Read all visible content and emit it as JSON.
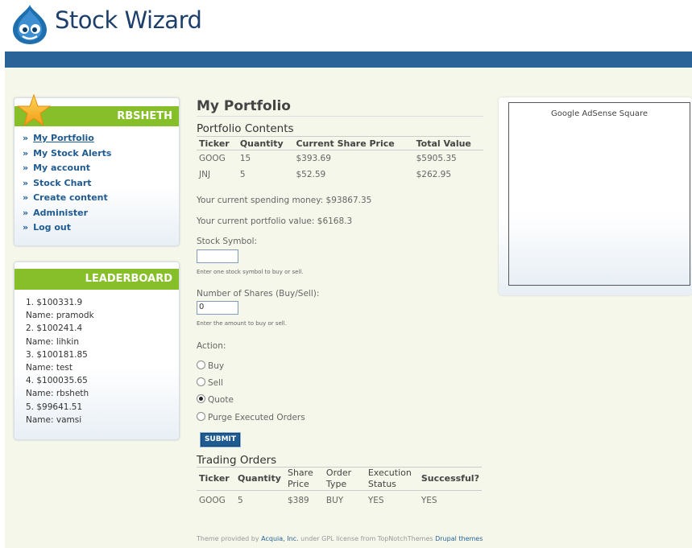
{
  "site": {
    "title": "Stock Wizard"
  },
  "user_block": {
    "title": "RBSHETH",
    "menu": [
      {
        "label": "My Portfolio",
        "active": true
      },
      {
        "label": "My Stock Alerts"
      },
      {
        "label": "My account"
      },
      {
        "label": "Stock Chart"
      },
      {
        "label": "Create content"
      },
      {
        "label": "Administer"
      },
      {
        "label": "Log out"
      }
    ],
    "bullet": "»"
  },
  "leaderboard": {
    "title": "LEADERBOARD",
    "lines": [
      "1. $100331.9",
      "Name: pramodk",
      "2. $100241.4",
      "Name: lihkin",
      "3. $100181.85",
      "Name: test",
      "4. $100035.65",
      "Name: rbsheth",
      "5. $99641.51",
      "Name: vamsi"
    ]
  },
  "main": {
    "page_title": "My Portfolio",
    "portfolio_heading": "Portfolio Contents",
    "portfolio_headers": [
      "Ticker",
      "Quantity",
      "Current Share Price",
      "Total Value"
    ],
    "portfolio_rows": [
      [
        "GOOG",
        "15",
        "$393.69",
        "$5905.35"
      ],
      [
        "JNJ",
        "5",
        "$52.59",
        "$262.95"
      ]
    ],
    "spending_money": "Your current spending money: $93867.35",
    "portfolio_value": "Your current portfolio value: $6168.3",
    "symbol_label": "Stock Symbol:",
    "symbol_value": "",
    "symbol_help": "Enter one stock symbol to buy or sell.",
    "shares_label": "Number of Shares (Buy/Sell):",
    "shares_value": "0",
    "shares_help": "Enter the amount to buy or sell.",
    "action_label": "Action:",
    "actions": [
      {
        "label": "Buy",
        "selected": false
      },
      {
        "label": "Sell",
        "selected": false
      },
      {
        "label": "Quote",
        "selected": true
      },
      {
        "label": "Purge Executed Orders",
        "selected": false
      }
    ],
    "submit_label": "SUBMIT",
    "orders_heading": "Trading Orders",
    "orders_headers": [
      "Ticker",
      "Quantity",
      "Share Price",
      "Order Type",
      "Execution Status",
      "Successful?"
    ],
    "orders_rows": [
      [
        "GOOG",
        "5",
        "$389",
        "BUY",
        "YES",
        "YES"
      ]
    ]
  },
  "ad": {
    "text": "Google AdSense Square"
  },
  "footer": {
    "prefix": "Theme provided by ",
    "link1": "Acquia, Inc.",
    "middle": " under GPL license from TopNotchThemes ",
    "link2": "Drupal themes"
  },
  "colors": {
    "header_bar": "#2a6397",
    "block_title": "#86bf2a",
    "link": "#1f5b91"
  }
}
